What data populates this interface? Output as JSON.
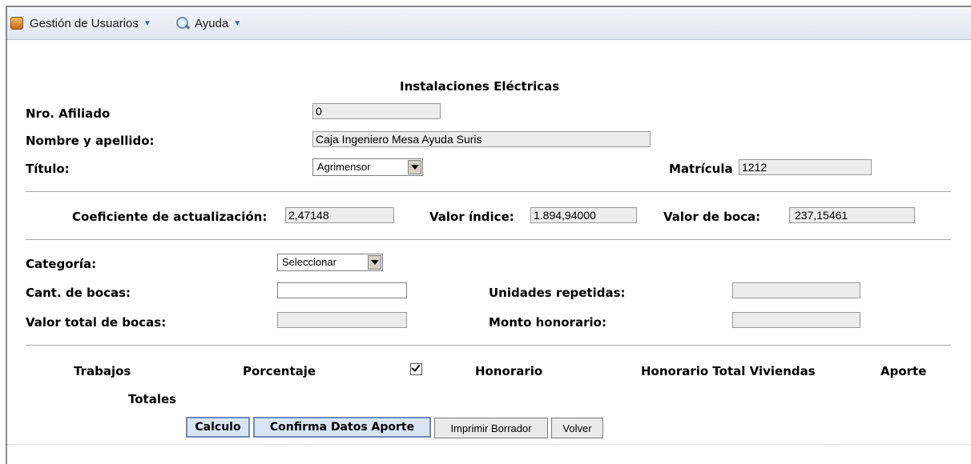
{
  "menu": {
    "items": [
      {
        "label": "Gestión de Usuarios",
        "icon": "users-icon"
      },
      {
        "label": "Ayuda",
        "icon": "help-search-icon"
      }
    ]
  },
  "form": {
    "title": "Instalaciones Eléctricas",
    "nro_afiliado": {
      "label": "Nro. Afiliado",
      "value": "0"
    },
    "nombre": {
      "label": "Nombre y apellido:",
      "value": "Caja Ingeniero Mesa Ayuda Suris"
    },
    "titulo": {
      "label": "Título:",
      "selected": "Agrimensor"
    },
    "matricula": {
      "label": "Matrícula",
      "value": "1212"
    },
    "coeficiente": {
      "label": "Coeficiente de actualización:",
      "value": "2,47148"
    },
    "valor_indice": {
      "label": "Valor índice:",
      "value": "1.894,94000"
    },
    "valor_boca": {
      "label": "Valor de boca:",
      "value": "237,15461"
    },
    "categoria": {
      "label": "Categoría:",
      "selected": "Seleccionar"
    },
    "cant_bocas": {
      "label": "Cant. de bocas:",
      "value": ""
    },
    "unidades_repetidas": {
      "label": "Unidades repetidas:",
      "value": ""
    },
    "valor_total_bocas": {
      "label": "Valor total de bocas:",
      "value": ""
    },
    "monto_honorario": {
      "label": "Monto honorario:",
      "value": ""
    }
  },
  "table": {
    "headers": {
      "trabajos": "Trabajos",
      "porcentaje": "Porcentaje",
      "honorario": "Honorario",
      "honorario_total": "Honorario Total Viviendas",
      "aporte": "Aporte"
    },
    "checkbox_checked": true,
    "totales": "Totales"
  },
  "buttons": {
    "calculo": "Calculo",
    "confirma": "Confirma Datos Aporte",
    "imprimir": "Imprimir Borrador",
    "volver": "Volver"
  },
  "colors": {
    "menubar": "#dfe6f0",
    "input_bg": "#ececec",
    "primary_button_bg": "#d9e5f7",
    "menu_arrow": "#3b69b6"
  }
}
